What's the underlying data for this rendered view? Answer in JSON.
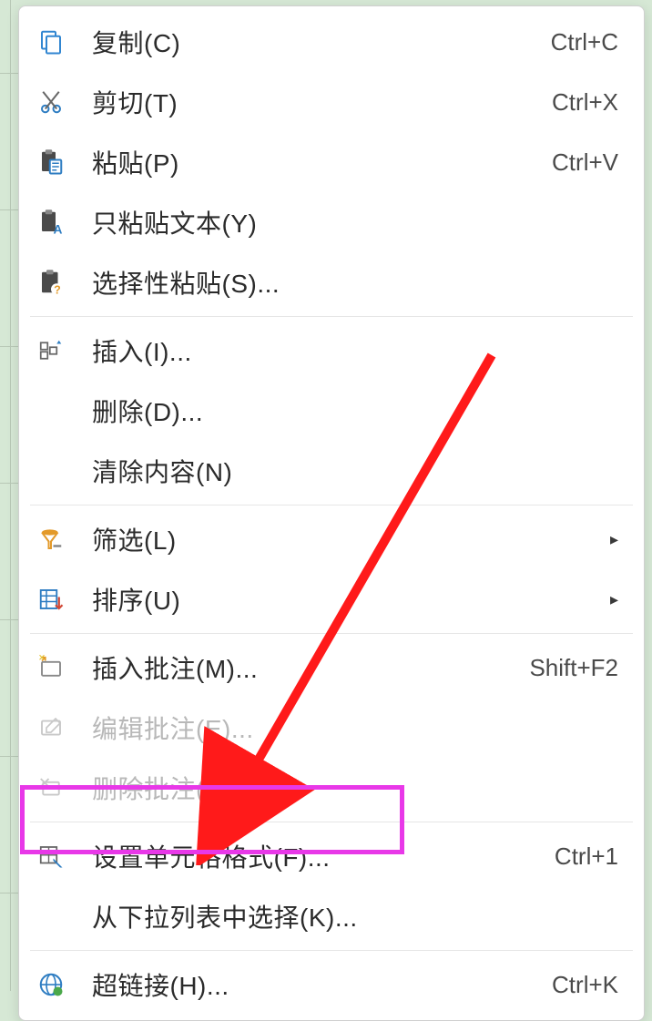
{
  "menu": {
    "copy": {
      "label": "复制(C)",
      "shortcut": "Ctrl+C"
    },
    "cut": {
      "label": "剪切(T)",
      "shortcut": "Ctrl+X"
    },
    "paste": {
      "label": "粘贴(P)",
      "shortcut": "Ctrl+V"
    },
    "pasteText": {
      "label": "只粘贴文本(Y)",
      "shortcut": ""
    },
    "pasteSpecial": {
      "label": "选择性粘贴(S)...",
      "shortcut": ""
    },
    "insert": {
      "label": "插入(I)...",
      "shortcut": ""
    },
    "delete": {
      "label": "删除(D)...",
      "shortcut": ""
    },
    "clear": {
      "label": "清除内容(N)",
      "shortcut": ""
    },
    "filter": {
      "label": "筛选(L)",
      "shortcut": ""
    },
    "sort": {
      "label": "排序(U)",
      "shortcut": ""
    },
    "insertComment": {
      "label": "插入批注(M)...",
      "shortcut": "Shift+F2"
    },
    "editComment": {
      "label": "编辑批注(E)...",
      "shortcut": ""
    },
    "deleteComment": {
      "label": "删除批注(M)",
      "shortcut": ""
    },
    "formatCells": {
      "label": "设置单元格格式(F)...",
      "shortcut": "Ctrl+1"
    },
    "pickFromList": {
      "label": "从下拉列表中选择(K)...",
      "shortcut": ""
    },
    "hyperlink": {
      "label": "超链接(H)...",
      "shortcut": "Ctrl+K"
    }
  },
  "annotation": {
    "highlightedItem": "formatCells"
  }
}
